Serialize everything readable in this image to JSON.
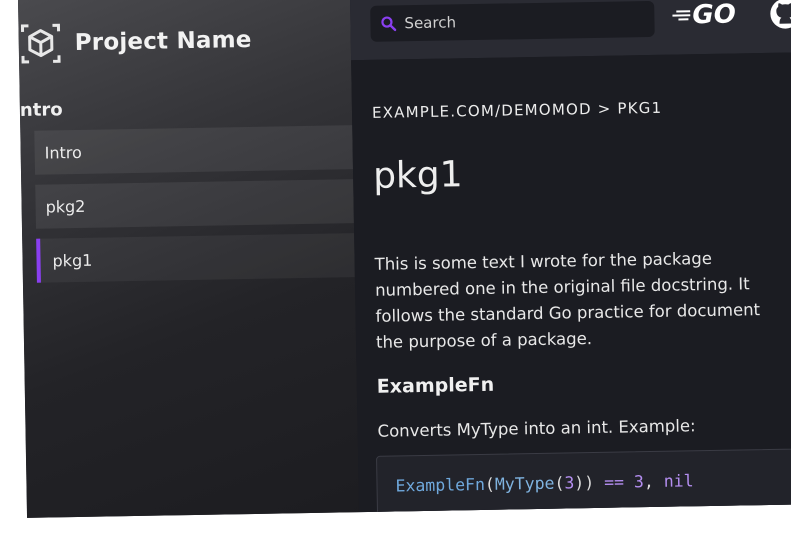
{
  "brand": {
    "name": "Project Name",
    "logo_icon": "cube-icon"
  },
  "sidebar": {
    "section_title": "ntro",
    "items": [
      {
        "label": "Intro",
        "active": false
      },
      {
        "label": "pkg2",
        "active": false
      },
      {
        "label": "pkg1",
        "active": true
      }
    ],
    "active_color": "#8a3ff0"
  },
  "topbar": {
    "search": {
      "placeholder": "Search",
      "value": "",
      "icon": "search-icon",
      "icon_color": "#8a3ff0"
    },
    "go_logo": "GO",
    "github_icon": "github-icon"
  },
  "main": {
    "breadcrumb": "EXAMPLE.COM/DEMOMOD > PKG1",
    "title": "pkg1",
    "paragraph_lines": [
      "This is some text I wrote for the package",
      "numbered one in the original file docstring. It",
      "follows the standard Go practice for document",
      "the purpose of a package."
    ],
    "section_heading": "ExampleFn",
    "fn_description": "Converts MyType into an int. Example:",
    "code": {
      "fn": "ExampleFn",
      "open1": "(",
      "type": "MyType",
      "open2": "(",
      "num": "3",
      "close": "))",
      "op": "==",
      "num2": "3",
      "comma": ",",
      "kw": "nil"
    }
  }
}
